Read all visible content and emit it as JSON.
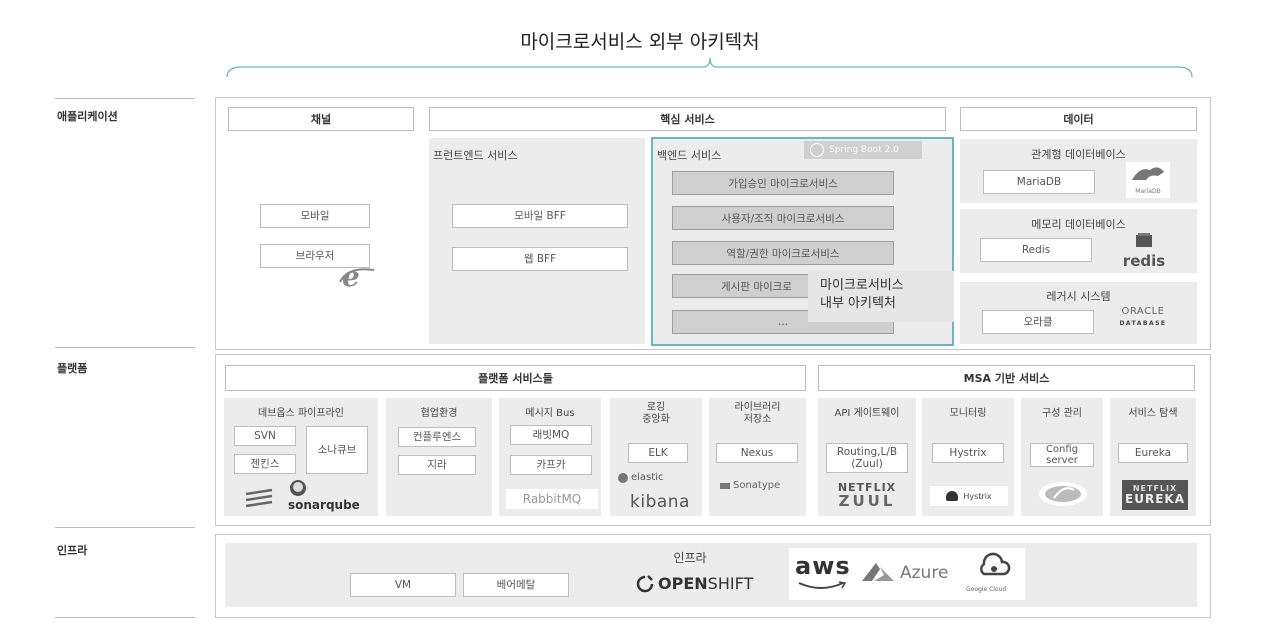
{
  "title": "마이크로서비스 외부 아키텍처",
  "labels": {
    "application": "애플리케이션",
    "platform": "플랫폼",
    "infra": "인프라"
  },
  "channel": {
    "header": "채널",
    "mobile": "모바일",
    "browser": "브라우저"
  },
  "core": {
    "header": "핵심 서비스",
    "frontend": {
      "title": "프런트엔드 서비스",
      "mobile_bff": "모바일 BFF",
      "web_bff": "웹 BFF"
    },
    "backend": {
      "title": "백엔드 서비스",
      "badge": "Spring Boot 2.0",
      "items": [
        "가입승인 마이크로서비스",
        "사용자/조직 마이크로서비스",
        "역할/권한 마이크로서비스",
        "게시판 마이크로",
        "..."
      ],
      "overlay_line1": "마이크로서비스",
      "overlay_line2": "내부 아키텍처"
    }
  },
  "data": {
    "header": "데이터",
    "rdb": {
      "title": "관계형 데이터베이스",
      "item": "MariaDB",
      "logo": "MariaDB"
    },
    "memdb": {
      "title": "메모리 데이터베이스",
      "item": "Redis",
      "logo": "redis"
    },
    "legacy": {
      "title": "레거시 시스템",
      "item": "오라클",
      "logo1": "ORACLE",
      "logo2": "DATABASE"
    }
  },
  "platform": {
    "services_header": "플랫폼 서비스들",
    "msa_header": "MSA 기반 서비스",
    "devops": {
      "title": "데브옵스 파이프라인",
      "svn": "SVN",
      "jenkins": "젠킨스",
      "sonarqube": "소나큐브",
      "logo": "sonarqube"
    },
    "collab": {
      "title": "협업환경",
      "confluence": "컨플루엔스",
      "jira": "지라"
    },
    "messagebus": {
      "title": "메시지 Bus",
      "rabbitmq": "래빗MQ",
      "kafka": "카프카",
      "logo": "RabbitMQ"
    },
    "logging": {
      "title1": "로깅",
      "title2": "중앙화",
      "elk": "ELK",
      "logo1": "elastic",
      "logo2": "kibana"
    },
    "library": {
      "title1": "라이브러리",
      "title2": "저장소",
      "nexus": "Nexus",
      "logo": "Sonatype"
    },
    "gateway": {
      "title": "API 게이트웨이",
      "item1": "Routing,L/B",
      "item2": "(Zuul)",
      "logo1": "NETFLIX",
      "logo2": "ZUUL"
    },
    "monitoring": {
      "title": "모니터링",
      "item": "Hystrix",
      "logo": "Hystrix"
    },
    "config": {
      "title": "구성 관리",
      "item1": "Config",
      "item2": "server"
    },
    "discovery": {
      "title": "서비스 탐색",
      "item": "Eureka",
      "logo1": "NETFLIX",
      "logo2": "EUREKA"
    }
  },
  "infra": {
    "title": "인프라",
    "vm": "VM",
    "baremetal": "베어메탈",
    "openshift_bold": "OPEN",
    "openshift_light": "SHIFT",
    "aws": "aws",
    "azure": "Azure",
    "gcloud": "Google Cloud"
  },
  "colors": {
    "teal": "#6bb6c3",
    "border": "#c8c8c8",
    "gray": "#ececec"
  }
}
